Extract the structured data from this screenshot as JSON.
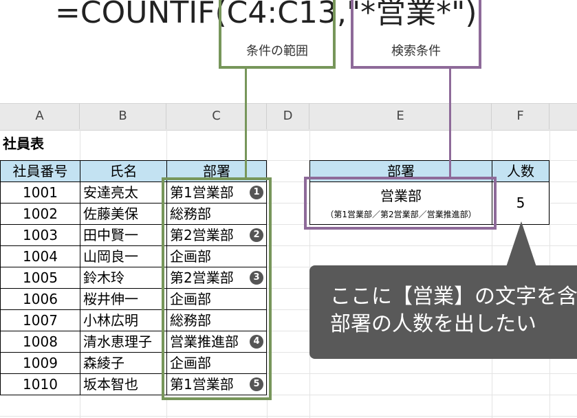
{
  "formula": {
    "prefix": "=COUNTIF(",
    "range": "C4:C13",
    "comma": ",",
    "criteria": "\"*営業*\"",
    "suffix": ")"
  },
  "callouts": {
    "range_label": "条件の範囲",
    "criteria_label": "検索条件",
    "range_color": "#77965a",
    "criteria_color": "#8e6a99"
  },
  "columns": [
    "A",
    "B",
    "C",
    "D",
    "E",
    "F"
  ],
  "title": "社員表",
  "table": {
    "headers": [
      "社員番号",
      "氏名",
      "部署"
    ],
    "rows": [
      {
        "id": "1001",
        "name": "安達亮太",
        "dept": "第1営業部",
        "badge": "1"
      },
      {
        "id": "1002",
        "name": "佐藤美保",
        "dept": "総務部",
        "badge": ""
      },
      {
        "id": "1003",
        "name": "田中賢一",
        "dept": "第2営業部",
        "badge": "2"
      },
      {
        "id": "1004",
        "name": "山岡良一",
        "dept": "企画部",
        "badge": ""
      },
      {
        "id": "1005",
        "name": "鈴木玲",
        "dept": "第2営業部",
        "badge": "3"
      },
      {
        "id": "1006",
        "name": "桜井伸一",
        "dept": "企画部",
        "badge": ""
      },
      {
        "id": "1007",
        "name": "小林広明",
        "dept": "総務部",
        "badge": ""
      },
      {
        "id": "1008",
        "name": "清水恵理子",
        "dept": "営業推進部",
        "badge": "4"
      },
      {
        "id": "1009",
        "name": "森綾子",
        "dept": "企画部",
        "badge": ""
      },
      {
        "id": "1010",
        "name": "坂本智也",
        "dept": "第1営業部",
        "badge": "5"
      }
    ]
  },
  "summary": {
    "header_dept": "部署",
    "header_count": "人数",
    "dept_main": "営業部",
    "dept_note": "（第1営業部／第2営業部／営業推進部）",
    "count": "5"
  },
  "bubble": {
    "line1": "ここに【営業】の文字を含む",
    "line2": "部署の人数を出したい",
    "color": "#595959"
  },
  "colors": {
    "header_fill": "#c3e2f2",
    "range_border": "#77965a",
    "criteria_border": "#8e6a99"
  }
}
